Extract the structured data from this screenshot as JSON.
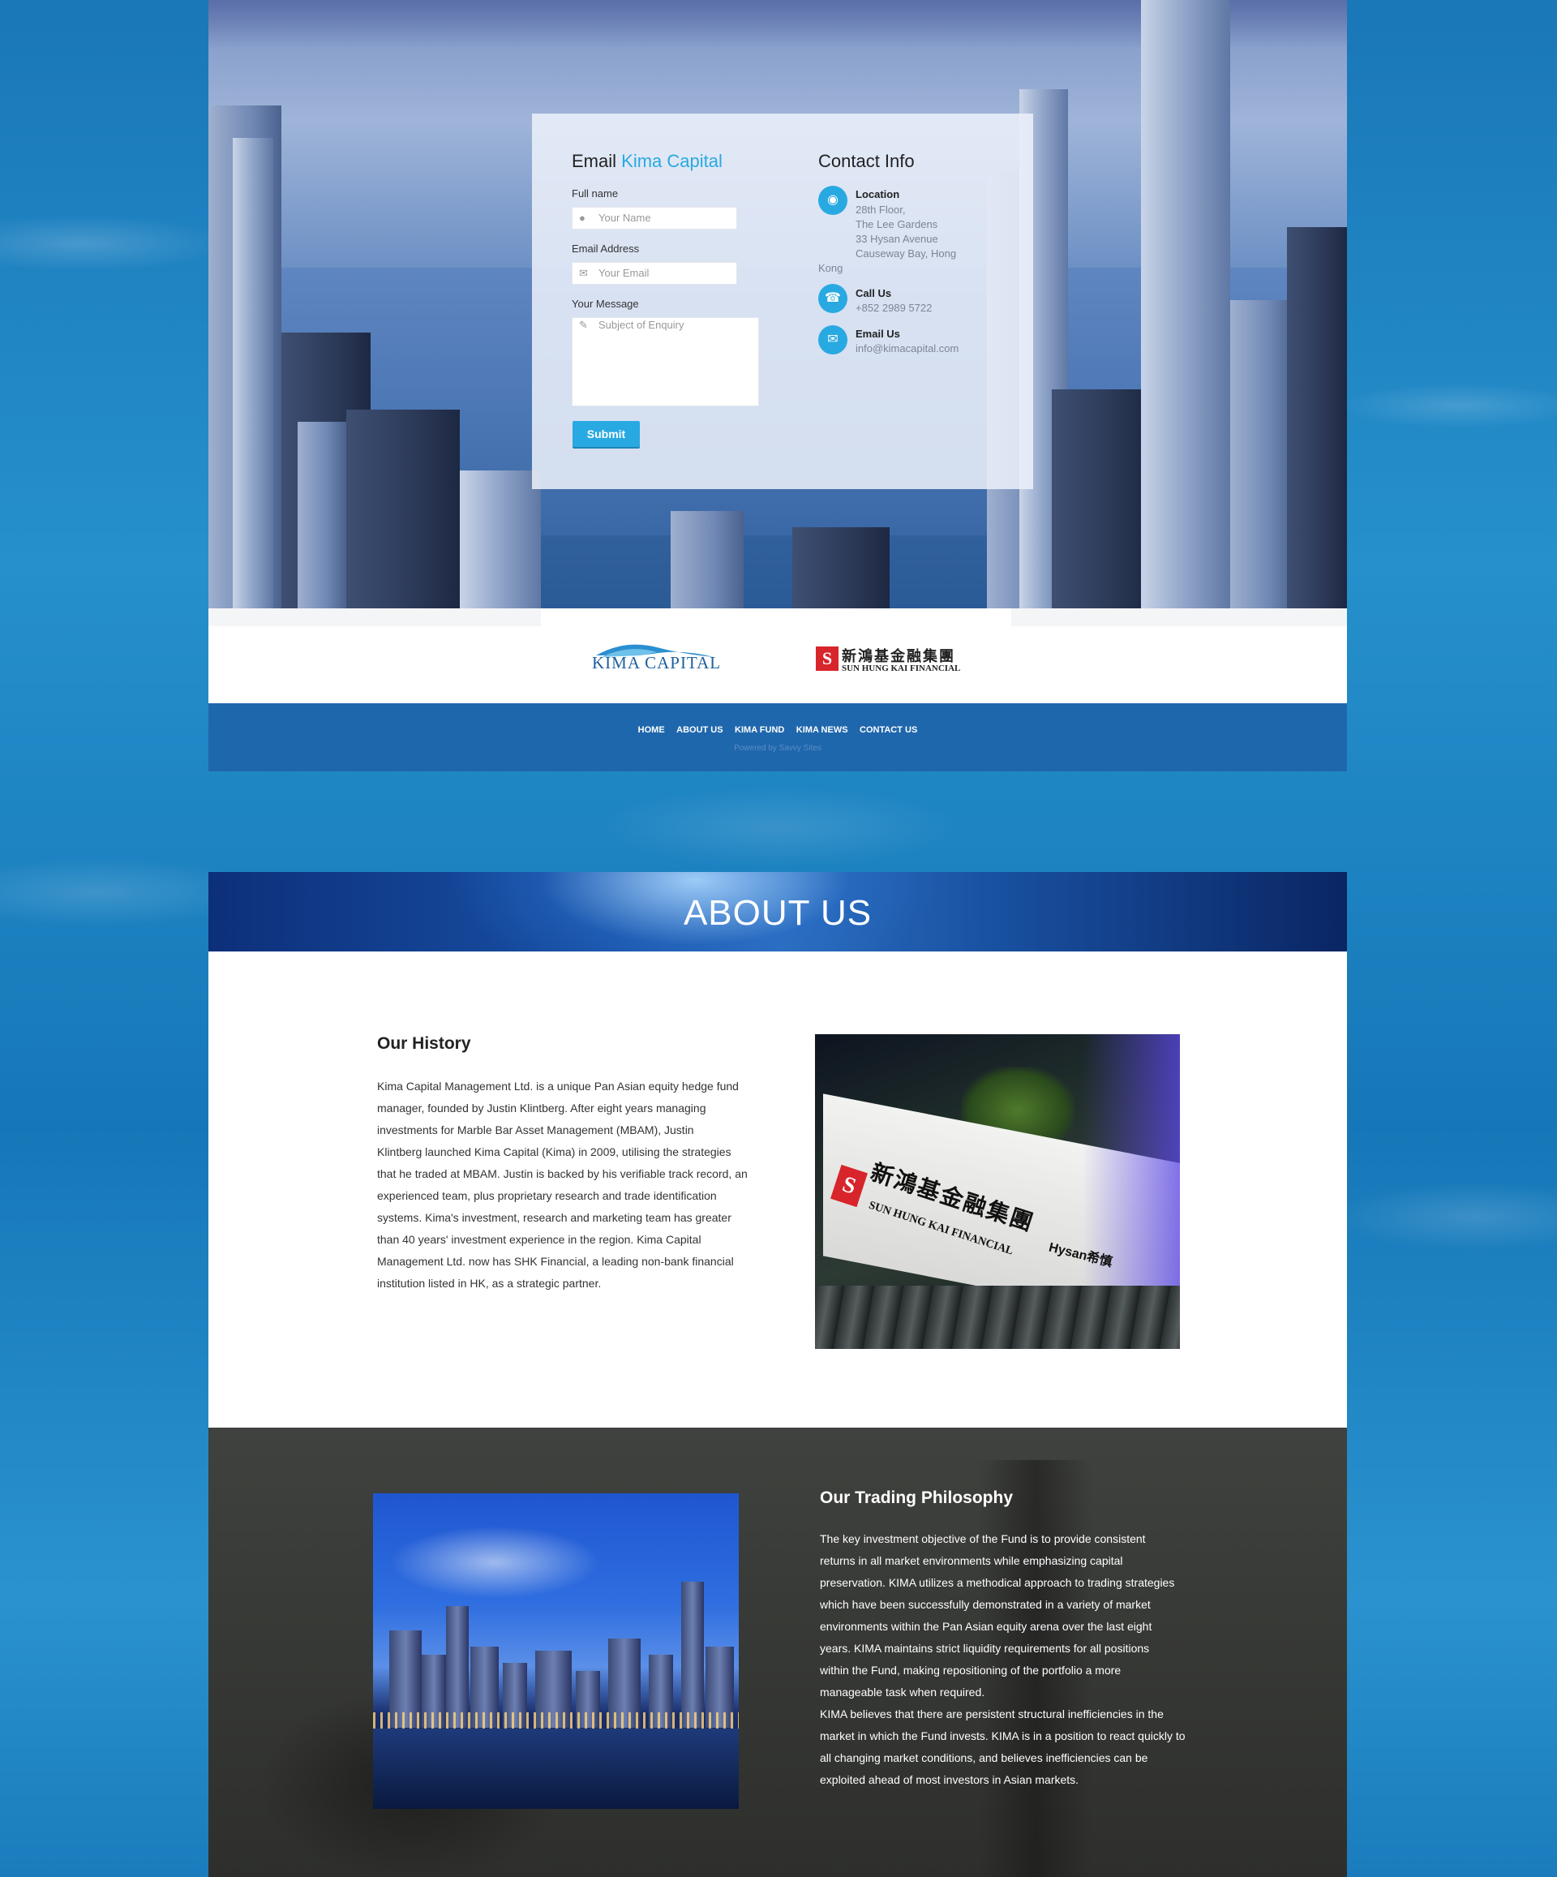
{
  "contact_form": {
    "title_prefix": "Email",
    "title_brand": "Kima Capital",
    "fullname_label": "Full name",
    "fullname_placeholder": "Your Name",
    "email_label": "Email Address",
    "email_placeholder": "Your Email",
    "message_label": "Your Message",
    "message_placeholder": "Subject of Enquiry",
    "submit_label": "Submit"
  },
  "contact_info": {
    "title": "Contact Info",
    "location_head": "Location",
    "location_lines": [
      "28th Floor,",
      "The Lee Gardens",
      "33 Hysan Avenue",
      "Causeway Bay, Hong"
    ],
    "location_last": "Kong",
    "call_head": "Call Us",
    "phone": "+852 2989 5722",
    "email_head": "Email Us",
    "email": "info@kimacapital.com"
  },
  "logos": {
    "kima": "KIMA CAPITAL",
    "shk_mark": "S",
    "shk_cn": "新鴻基金融集團",
    "shk_en": "SUN HUNG KAI FINANCIAL"
  },
  "footer": {
    "nav": [
      "HOME",
      "ABOUT US",
      "KIMA FUND",
      "KIMA NEWS",
      "CONTACT US"
    ],
    "powered": "Powered by Savvy Sites"
  },
  "about": {
    "banner_title": "ABOUT US",
    "history_title": "Our History",
    "history_lines": [
      "Kima Capital Management Ltd. is a unique Pan Asian equity hedge fund",
      "manager, founded by Justin Klintberg. After eight years managing",
      "investments for Marble Bar Asset Management (MBAM), Justin",
      "Klintberg launched Kima Capital (Kima) in 2009, utilising the strategies",
      "that he traded at MBAM. Justin is backed by his verifiable track record, an",
      "experienced team, plus proprietary research and trade identification",
      "systems. Kima's investment, research and marketing team has greater",
      "than 40 years' investment experience in the region. Kima Capital",
      "Management Ltd. now has SHK Financial, a leading non-bank financial",
      "institution listed in HK, as a strategic partner."
    ],
    "photo_sign_cn": "新鴻基金融集團",
    "photo_sign_en": "SUN HUNG KAI FINANCIAL",
    "photo_sign_hysan": "Hysan希慎",
    "philosophy_title": "Our Trading Philosophy",
    "philosophy_lines": [
      "The key investment objective of the Fund is to provide consistent",
      "returns in all market environments while emphasizing capital",
      "preservation. KIMA utilizes a methodical approach to trading strategies",
      "which have been successfully demonstrated in a variety of market",
      "environments within the Pan Asian equity arena over the last eight",
      "years. KIMA maintains strict liquidity requirements for all positions",
      "within the Fund, making repositioning of the portfolio a more",
      "manageable task when required.",
      "KIMA believes that there are persistent structural inefficiencies in the",
      "market in which the Fund invests. KIMA is in a position to react quickly to",
      "all changing market conditions, and believes inefficiencies can be",
      "exploited ahead of most investors in Asian markets."
    ]
  },
  "colors": {
    "accent": "#29a9e1",
    "footer_bg": "#1f67ad",
    "brand_blue": "#1d5f9f",
    "shk_red": "#d8242b"
  }
}
